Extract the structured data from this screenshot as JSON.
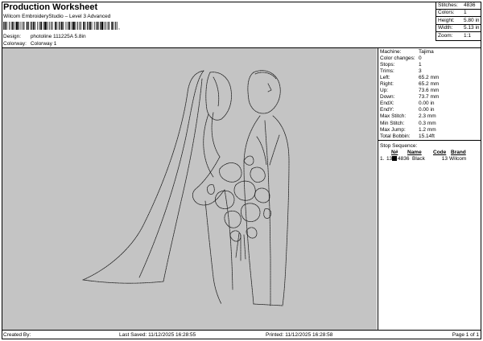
{
  "header": {
    "title": "Production Worksheet",
    "subtitle": "Wilcom EmbroideryStudio – Level 3 Advanced",
    "barcode_suffix": ",",
    "design_label": "Design:",
    "design_value": "photoline 111225A 5.8in",
    "colorway_label": "Colorway:",
    "colorway_value": "Colorway 1"
  },
  "stats": [
    {
      "label": "Stitches:",
      "value": "4836"
    },
    {
      "label": "Colors:",
      "value": "1"
    },
    {
      "label": "Height:",
      "value": "5.80 in"
    },
    {
      "label": "Width:",
      "value": "5.13 in"
    },
    {
      "label": "Zoom:",
      "value": "1:1"
    }
  ],
  "machine_info": [
    {
      "label": "Machine:",
      "value": "Tajima"
    },
    {
      "label": "Color changes:",
      "value": "0"
    },
    {
      "label": "Stops:",
      "value": "1"
    },
    {
      "label": "Trims:",
      "value": "3"
    },
    {
      "label": "Left:",
      "value": "65.2 mm"
    },
    {
      "label": "Right:",
      "value": "65.2 mm"
    },
    {
      "label": "Up:",
      "value": "73.6 mm"
    },
    {
      "label": "Down:",
      "value": "73.7 mm"
    },
    {
      "label": "EndX:",
      "value": "0.00 in"
    },
    {
      "label": "EndY:",
      "value": "0.00 in"
    },
    {
      "label": "Max Stitch:",
      "value": "2.3 mm"
    },
    {
      "label": "Min Stitch:",
      "value": "0.3 mm"
    },
    {
      "label": "Max Jump:",
      "value": "1.2 mm"
    },
    {
      "label": "Total Bobbin:",
      "value": "15.14ft"
    }
  ],
  "stop_sequence": {
    "title": "Stop Sequence:",
    "headers": {
      "n": "N#",
      "name": "Name",
      "code": "Code",
      "brand": "Brand"
    },
    "rows": [
      {
        "index": "1.",
        "n": "13",
        "stitches": "4836",
        "name": "Black",
        "code": "13",
        "brand": "Wilcom",
        "color": "#000000"
      }
    ]
  },
  "footer": {
    "created_by": "Created By:",
    "last_saved": "Last Saved: 11/12/2025 16:28:55",
    "printed": "Printed: 11/12/2025 16:28:58",
    "page": "Page 1 of 1"
  },
  "colors": {
    "design_background": "#c4c4c4",
    "stitch": "#1a1a1a"
  }
}
